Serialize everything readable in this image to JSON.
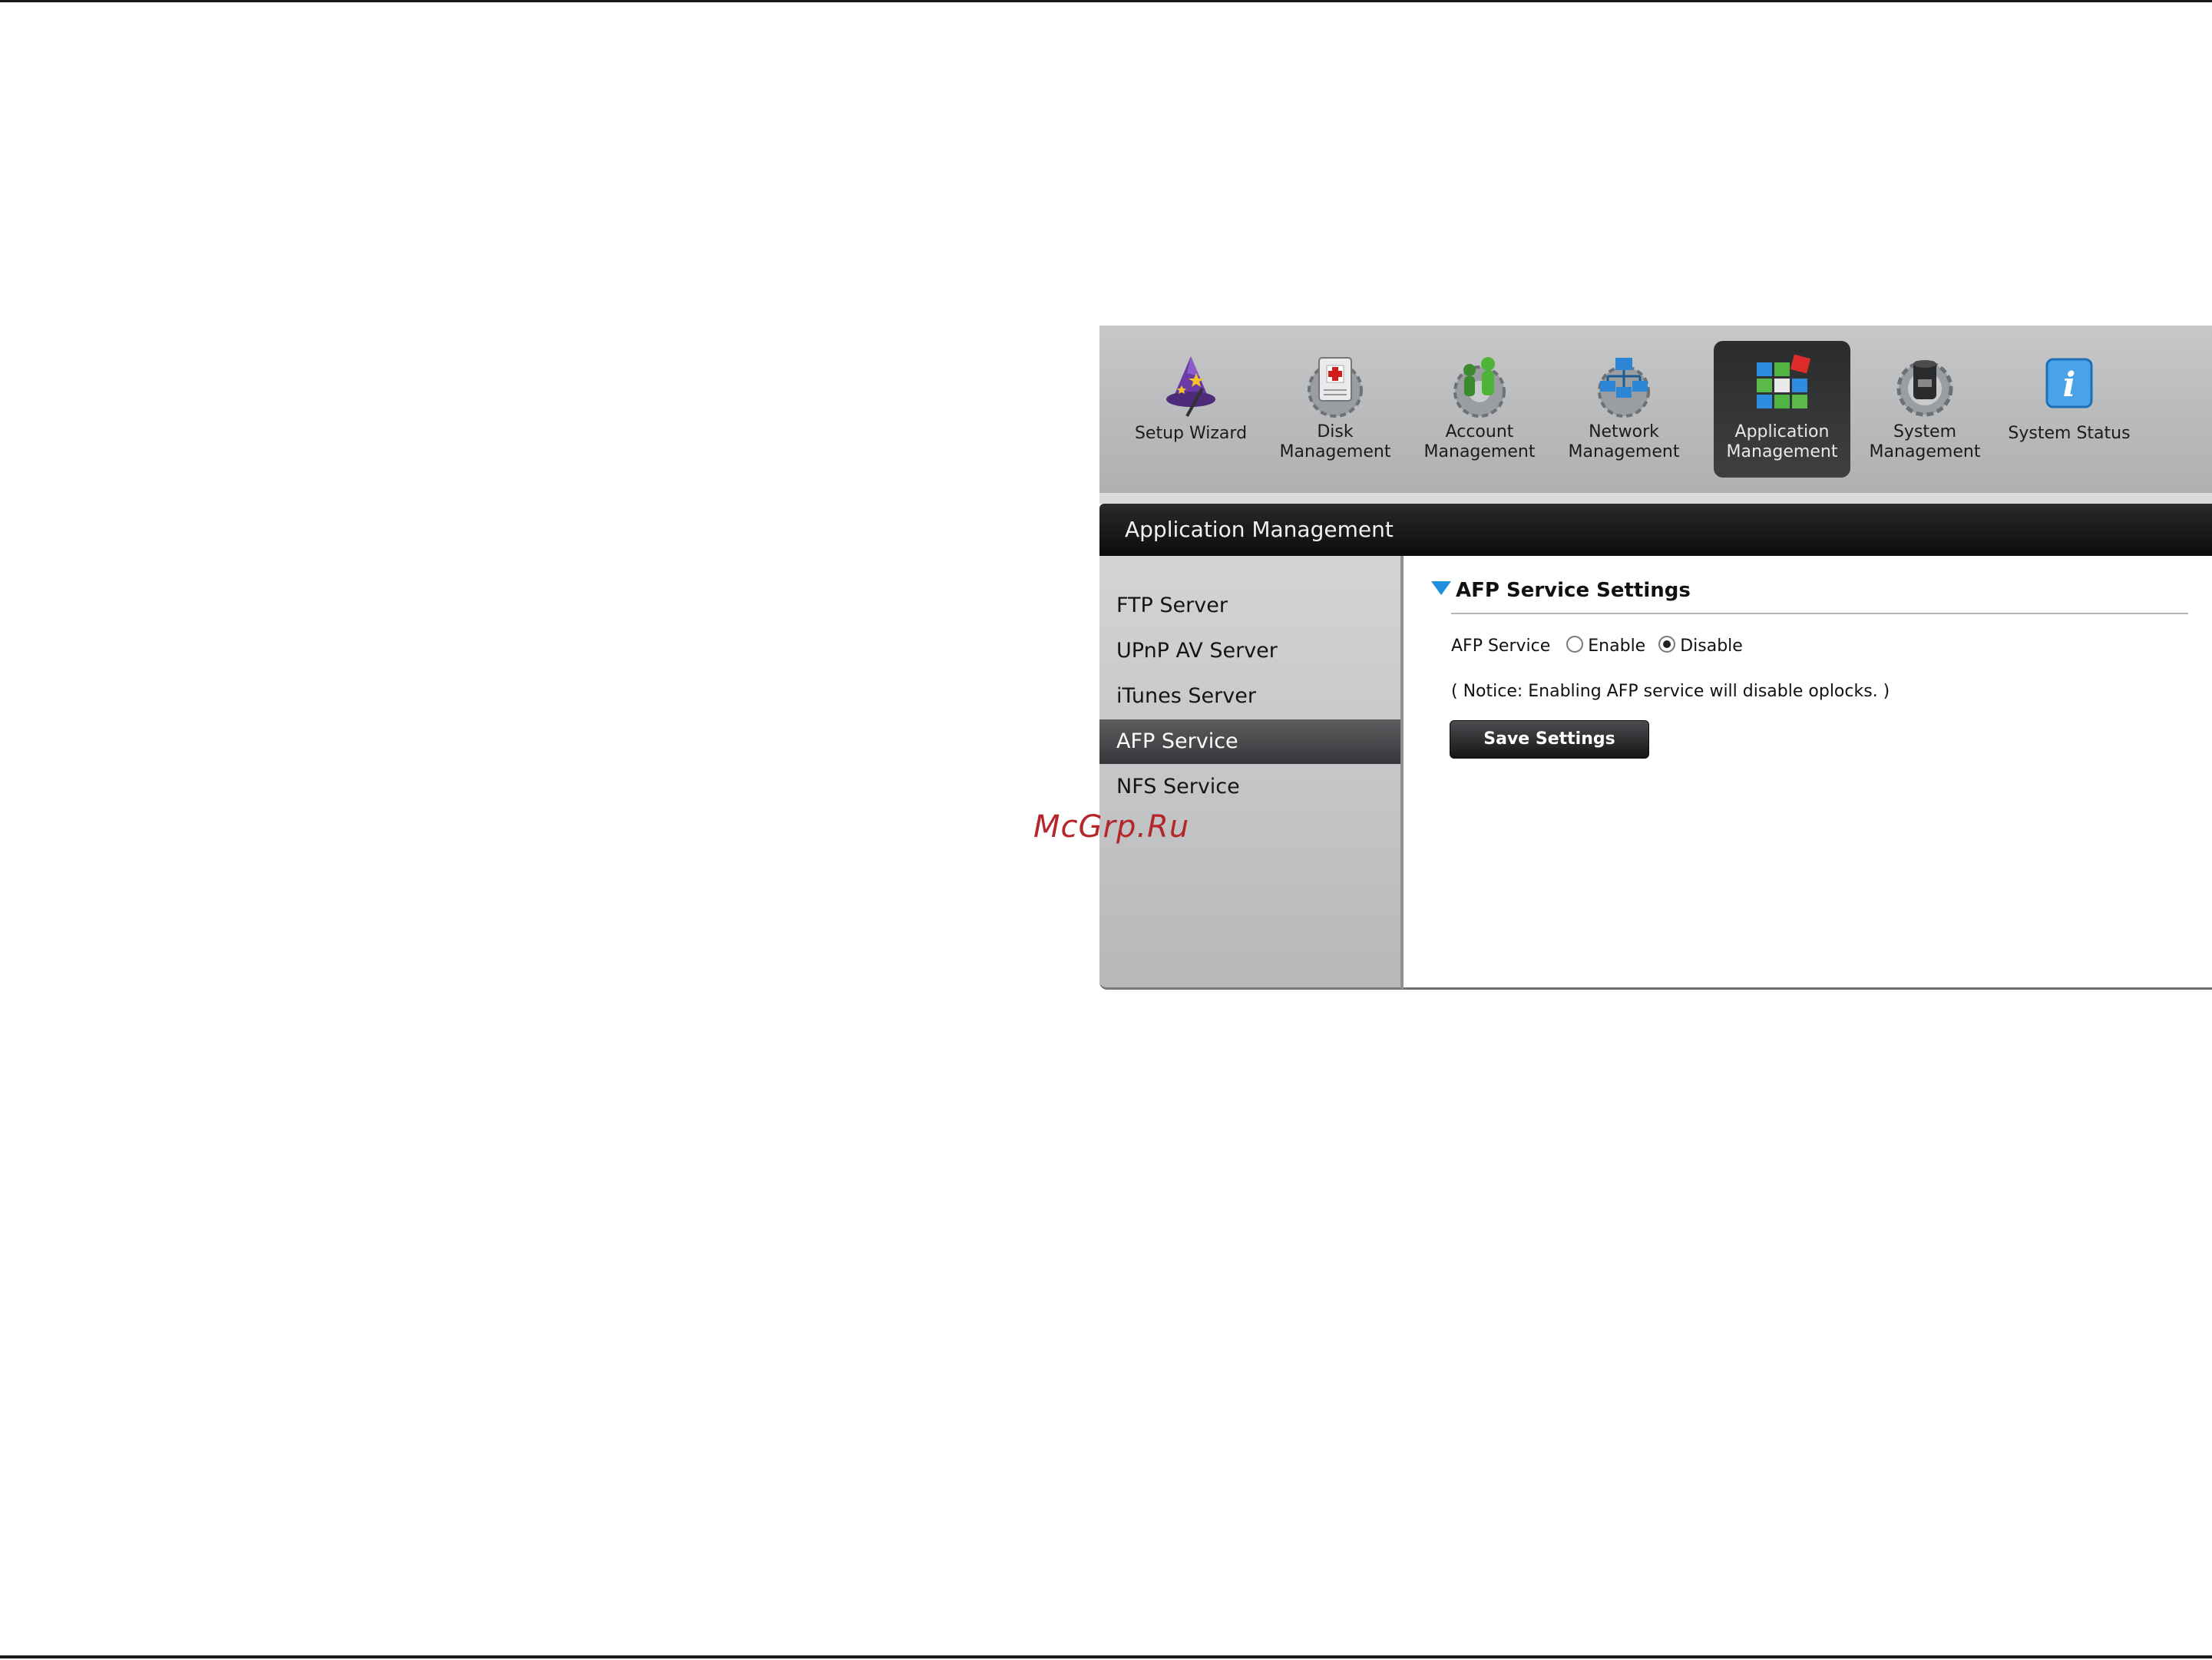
{
  "toolbar": {
    "items": [
      {
        "label_line1": "Setup Wizard",
        "label_line2": "",
        "icon": "wizard-icon",
        "active": false
      },
      {
        "label_line1": "Disk",
        "label_line2": "Management",
        "icon": "disk-icon",
        "active": false
      },
      {
        "label_line1": "Account",
        "label_line2": "Management",
        "icon": "account-icon",
        "active": false
      },
      {
        "label_line1": "Network",
        "label_line2": "Management",
        "icon": "network-icon",
        "active": false
      },
      {
        "label_line1": "Application",
        "label_line2": "Management",
        "icon": "application-icon",
        "active": true
      },
      {
        "label_line1": "System",
        "label_line2": "Management",
        "icon": "system-icon",
        "active": false
      },
      {
        "label_line1": "System Status",
        "label_line2": "",
        "icon": "info-icon",
        "active": false
      }
    ]
  },
  "header": {
    "title": "Application Management"
  },
  "sidebar": {
    "items": [
      {
        "label": "FTP Server",
        "active": false
      },
      {
        "label": "UPnP AV Server",
        "active": false
      },
      {
        "label": "iTunes Server",
        "active": false
      },
      {
        "label": "AFP Service",
        "active": true
      },
      {
        "label": "NFS Service",
        "active": false
      }
    ]
  },
  "main": {
    "section_title": "AFP Service Settings",
    "afp_service_label": "AFP Service",
    "enable_label": "Enable",
    "disable_label": "Disable",
    "selected": "Disable",
    "notice": "( Notice: Enabling AFP service will disable oplocks. )",
    "save_button": "Save Settings"
  },
  "watermark": "McGrp.Ru",
  "colors": {
    "accent_triangle": "#1f8fe0",
    "active_tab": "#2f3032",
    "watermark": "#b5262b"
  }
}
